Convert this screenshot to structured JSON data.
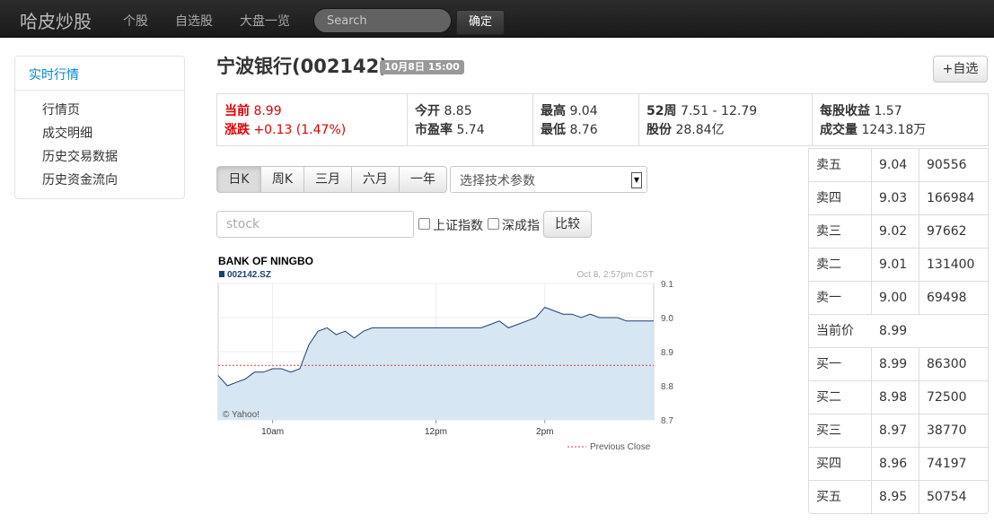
{
  "navbar": {
    "brand": "哈皮炒股",
    "links": [
      "个股",
      "自选股",
      "大盘一览"
    ],
    "search_placeholder": "Search",
    "confirm_label": "确定"
  },
  "sidebar": {
    "header": "实时行情",
    "items": [
      "行情页",
      "成交明细",
      "历史交易数据",
      "历史资金流向"
    ]
  },
  "stock": {
    "title": "宁波银行(002142)",
    "time_badge": "10月8日 15:00",
    "watch_label": "+自选"
  },
  "info": {
    "current_label": "当前",
    "current_value": "8.99",
    "change_label": "涨跌",
    "change_value": "+0.13 (1.47%)",
    "open_label": "今开",
    "open_value": "8.85",
    "pe_label": "市盈率",
    "pe_value": "5.74",
    "high_label": "最高",
    "high_value": "9.04",
    "low_label": "最低",
    "low_value": "8.76",
    "week52_label": "52周",
    "week52_value": "7.51 - 12.79",
    "shares_label": "股份",
    "shares_value": "28.84亿",
    "eps_label": "每股收益",
    "eps_value": "1.57",
    "volume_label": "成交量",
    "volume_value": "1243.18万",
    "accent_red": "#e00000"
  },
  "controls": {
    "periods": [
      "日K",
      "周K",
      "三月",
      "六月",
      "一年"
    ],
    "active_period": "日K",
    "indicator_select": "选择技术参数",
    "stock_placeholder": "stock",
    "checkbox_sh": "上证指数",
    "checkbox_sz": "深成指",
    "compare_label": "比较"
  },
  "chart_data": {
    "type": "area",
    "title": "BANK OF NINGBO",
    "series_name": "002142.SZ",
    "timestamp": "Oct 8, 2:57pm CST",
    "credit": "© Yahoo!",
    "legend": "Previous Close",
    "x_ticks": [
      "10am",
      "12pm",
      "2pm"
    ],
    "y_ticks": [
      9.1,
      9.0,
      8.9,
      8.8,
      8.7
    ],
    "ylim": [
      8.7,
      9.1
    ],
    "previous_close": 8.86,
    "x": [
      "9:30",
      "9:35",
      "9:40",
      "9:45",
      "9:50",
      "9:55",
      "10:00",
      "10:05",
      "10:10",
      "10:15",
      "10:20",
      "10:25",
      "10:30",
      "10:35",
      "10:40",
      "10:45",
      "10:50",
      "10:55",
      "11:00",
      "11:05",
      "11:10",
      "11:15",
      "11:20",
      "11:25",
      "11:30",
      "13:00",
      "13:05",
      "13:10",
      "13:15",
      "13:20",
      "13:25",
      "13:30",
      "13:35",
      "13:40",
      "13:45",
      "13:50",
      "13:55",
      "14:00",
      "14:05",
      "14:10",
      "14:15",
      "14:20",
      "14:25",
      "14:30",
      "14:35",
      "14:40",
      "14:45",
      "14:50",
      "14:55",
      "15:00"
    ],
    "values": [
      8.83,
      8.8,
      8.81,
      8.82,
      8.84,
      8.84,
      8.85,
      8.85,
      8.84,
      8.85,
      8.92,
      8.96,
      8.97,
      8.95,
      8.96,
      8.94,
      8.96,
      8.97,
      8.97,
      8.97,
      8.97,
      8.97,
      8.97,
      8.97,
      8.97,
      8.97,
      8.97,
      8.97,
      8.97,
      8.97,
      8.97,
      8.98,
      8.99,
      8.97,
      8.98,
      8.99,
      9.0,
      9.03,
      9.02,
      9.01,
      9.01,
      9.0,
      9.01,
      9.0,
      9.0,
      9.0,
      8.99,
      8.99,
      8.99,
      8.99
    ],
    "line_color": "#1f3f6e",
    "fill_color": "#d6e6f2",
    "prev_close_color": "#d04040"
  },
  "orderbook": {
    "rows": [
      {
        "label": "卖五",
        "price": "9.04",
        "volume": "90556"
      },
      {
        "label": "卖四",
        "price": "9.03",
        "volume": "166984"
      },
      {
        "label": "卖三",
        "price": "9.02",
        "volume": "97662"
      },
      {
        "label": "卖二",
        "price": "9.01",
        "volume": "131400"
      },
      {
        "label": "卖一",
        "price": "9.00",
        "volume": "69498"
      },
      {
        "label": "当前价",
        "price": "8.99",
        "volume": ""
      },
      {
        "label": "买一",
        "price": "8.99",
        "volume": "86300"
      },
      {
        "label": "买二",
        "price": "8.98",
        "volume": "72500"
      },
      {
        "label": "买三",
        "price": "8.97",
        "volume": "38770"
      },
      {
        "label": "买四",
        "price": "8.96",
        "volume": "74197"
      },
      {
        "label": "买五",
        "price": "8.95",
        "volume": "50754"
      }
    ]
  }
}
